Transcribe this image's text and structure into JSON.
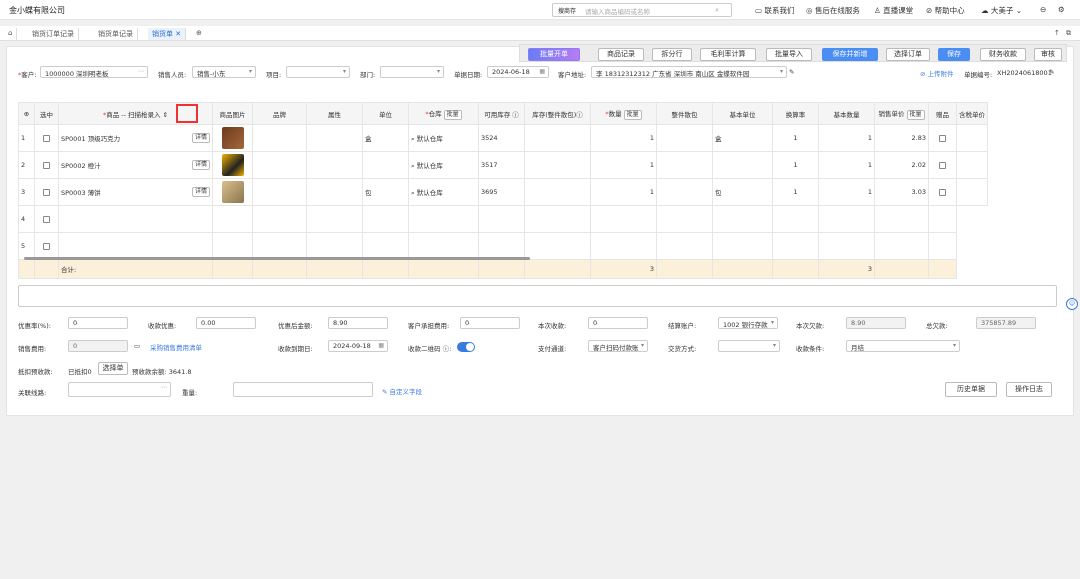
{
  "top": {
    "company": "金小蝶有限公司",
    "search_prefix": "搜商存",
    "search_placeholder": "请输入商品编码或名称",
    "links": [
      "联系我们",
      "售后在线服务",
      "直播课堂",
      "帮助中心",
      "大美子"
    ]
  },
  "tabs": [
    "销货订单记录",
    "销货单记录",
    "销货单"
  ],
  "toolbar": [
    "批量开单",
    "商品记录",
    "拆分行",
    "毛利率计算",
    "批量导入",
    "保存并新增",
    "选择订单",
    "保存",
    "财务收款",
    "审核"
  ],
  "form": {
    "customer_label": "客户:",
    "customer": "1000000 深圳明老板",
    "sales_label": "销售人员:",
    "sales": "销售-小东",
    "project_label": "项目:",
    "dept_label": "部门:",
    "date_label": "单据日期:",
    "date": "2024-06-18",
    "addr_label": "客户地址:",
    "addr": "李 18312312312 广东省 深圳市 南山区 金蝶软件园",
    "upload": "上传附件",
    "docno_label": "单据编号:",
    "docno": "XH20240618001"
  },
  "table": {
    "headers": [
      "选中",
      "商品 -- 扫描枪录入",
      "商品图片",
      "品牌",
      "属性",
      "单位",
      "仓库",
      "可用库存",
      "库存(整件散包)",
      "数量",
      "整件散包",
      "基本单位",
      "换算率",
      "基本数量",
      "销售单价",
      "赠品",
      "含税单价"
    ],
    "batch": "批量",
    "detail": "详情",
    "rows": [
      {
        "no": "1",
        "goods": "SP0001 顶级巧克力",
        "unit": "盒",
        "wh": "默认仓库",
        "stock": "3524",
        "qty": "1",
        "base_unit": "盒",
        "rate": "1",
        "base_qty": "1",
        "price": "2.83"
      },
      {
        "no": "2",
        "goods": "SP0002 橙汁",
        "unit": "",
        "wh": "默认仓库",
        "stock": "3517",
        "qty": "1",
        "base_unit": "",
        "rate": "1",
        "base_qty": "1",
        "price": "2.02"
      },
      {
        "no": "3",
        "goods": "SP0003 薄饼",
        "unit": "包",
        "wh": "默认仓库",
        "stock": "3695",
        "qty": "1",
        "base_unit": "包",
        "rate": "1",
        "base_qty": "1",
        "price": "3.03"
      },
      {
        "no": "4"
      },
      {
        "no": "5"
      }
    ],
    "total_label": "合计:",
    "total_qty": "3",
    "total_base": "3"
  },
  "bottom": {
    "discount_rate_label": "优惠率(%):",
    "discount_rate": "0",
    "collect_discount_label": "收款优惠:",
    "collect_discount": "0.00",
    "after_discount_label": "优惠后金额:",
    "after_discount": "8.90",
    "customer_fee_label": "客户承担费用:",
    "customer_fee": "0",
    "this_collect_label": "本次收款:",
    "this_collect": "0",
    "account_label": "结算账户:",
    "account": "1002 银行存款",
    "this_owe_label": "本次欠款:",
    "this_owe": "8.90",
    "total_owe_label": "总欠款:",
    "total_owe": "375857.89",
    "sales_fee_label": "销售费用:",
    "sales_fee": "0",
    "purchase_fee_link": "采购销售费用清单",
    "due_date_label": "收款到期日:",
    "due_date": "2024-09-18",
    "qr_label": "收款二维码",
    "pay_channel_label": "支付通道:",
    "pay_channel": "客户扫码付款账",
    "trade_label": "交货方式:",
    "collect_cond_label": "收款条件:",
    "collect_cond": "月结",
    "offset_label": "抵扣预收款:",
    "offset_text": "已抵扣0",
    "select_doc": "选择单",
    "prepay_balance": "预收款余额: 3641.8",
    "related_label": "关联线路:",
    "weight_label": "重量:",
    "custom_field": "自定义字段",
    "history_btn": "历史单据",
    "log_btn": "操作日志"
  }
}
